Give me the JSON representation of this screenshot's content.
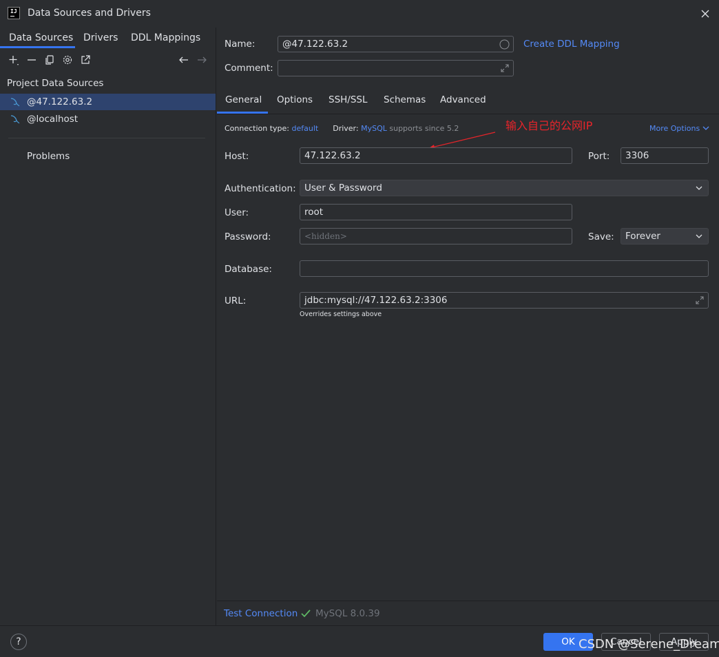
{
  "window": {
    "title": "Data Sources and Drivers"
  },
  "left_panel": {
    "tabs": [
      {
        "label": "Data Sources"
      },
      {
        "label": "Drivers"
      },
      {
        "label": "DDL Mappings"
      }
    ],
    "section_title": "Project Data Sources",
    "items": [
      {
        "label": "@47.122.63.2"
      },
      {
        "label": "@localhost"
      }
    ],
    "problems_label": "Problems"
  },
  "form": {
    "name_label": "Name:",
    "name_value": "@47.122.63.2",
    "create_ddl_link": "Create DDL Mapping",
    "comment_label": "Comment:",
    "comment_value": "",
    "tabs": [
      {
        "label": "General"
      },
      {
        "label": "Options"
      },
      {
        "label": "SSH/SSL"
      },
      {
        "label": "Schemas"
      },
      {
        "label": "Advanced"
      }
    ],
    "connection_type_label": "Connection type:",
    "connection_type_value": "default",
    "driver_label": "Driver:",
    "driver_value": "MySQL",
    "driver_note": "supports since 5.2",
    "more_options": "More Options",
    "annotation": "输入自己的公网IP",
    "host_label": "Host:",
    "host_value": "47.122.63.2",
    "port_label": "Port:",
    "port_value": "3306",
    "auth_label": "Authentication:",
    "auth_value": "User & Password",
    "user_label": "User:",
    "user_value": "root",
    "password_label": "Password:",
    "password_placeholder": "<hidden>",
    "save_label": "Save:",
    "save_value": "Forever",
    "database_label": "Database:",
    "database_value": "",
    "url_label": "URL:",
    "url_value": "jdbc:mysql://47.122.63.2:3306",
    "url_note": "Overrides settings above",
    "test_connection": "Test Connection",
    "test_result": "MySQL 8.0.39"
  },
  "footer": {
    "help": "?",
    "ok": "OK",
    "cancel": "Cancel",
    "apply": "Apply",
    "watermark": "CSDN @Serene_Dream"
  },
  "colors": {
    "accent": "#3574f0",
    "link": "#548af7",
    "annotation": "#e8242a",
    "success": "#5fb865"
  }
}
